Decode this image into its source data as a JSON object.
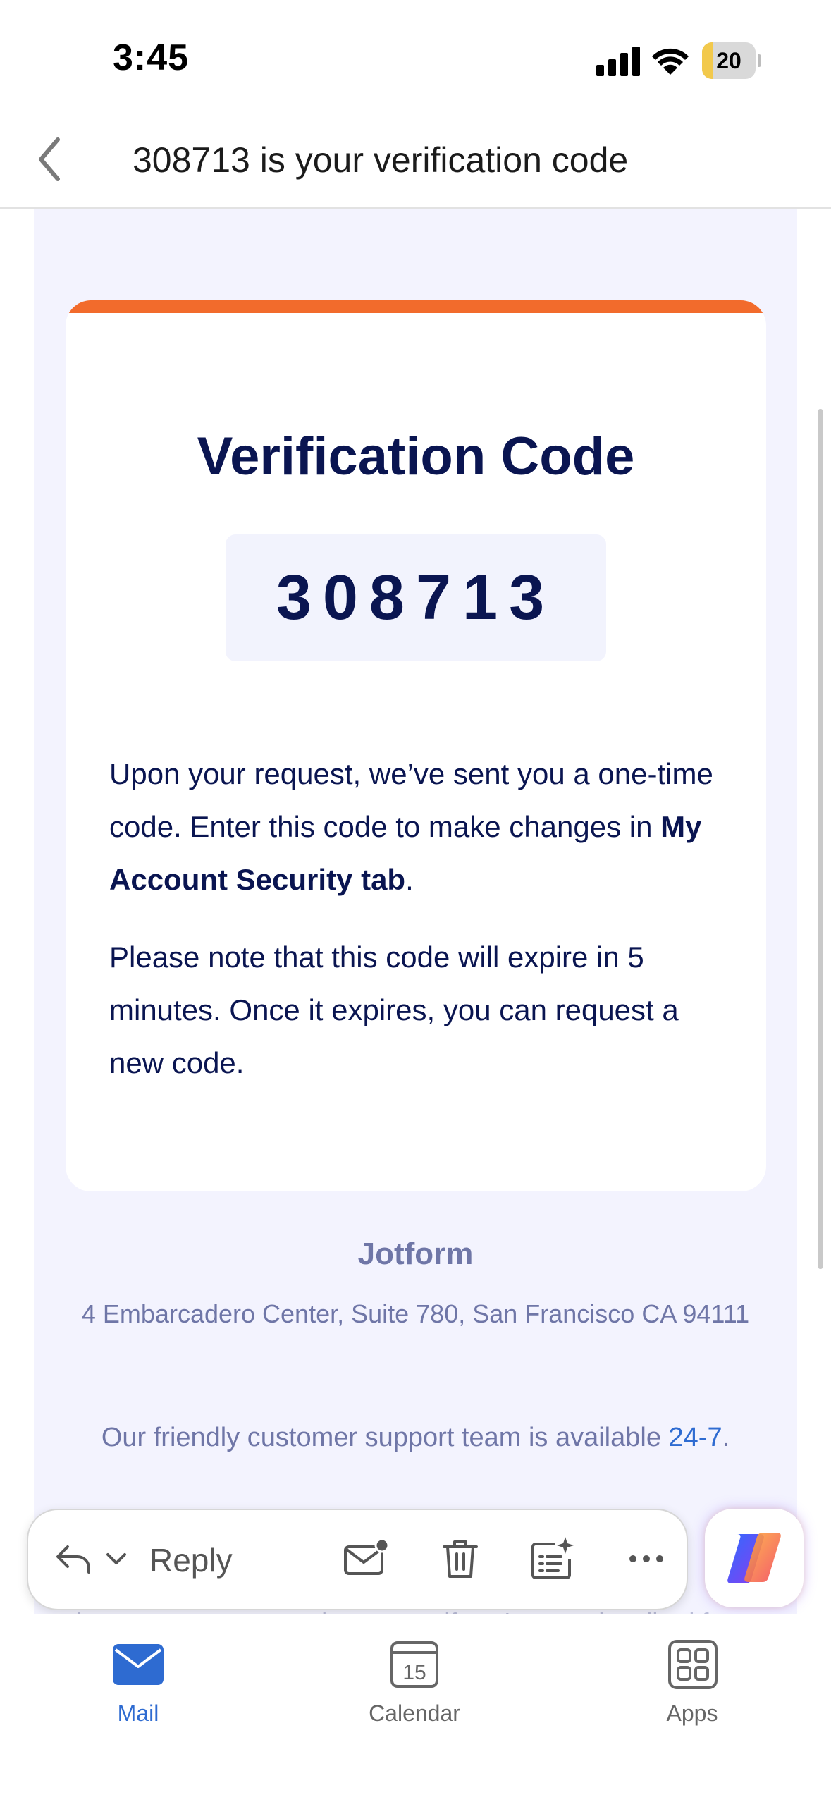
{
  "status_bar": {
    "time": "3:45",
    "battery": "20",
    "battery_level": 0.2
  },
  "header": {
    "subject": "308713 is your verification code"
  },
  "email": {
    "heading": "Verification Code",
    "code": "308713",
    "para1_prefix": "Upon your request, we’ve sent you a one-time code. Enter this code to make changes in ",
    "para1_bold": "My Account Security tab",
    "para1_suffix": ".",
    "para2": "Please note that this code will expire in 5 minutes. Once it expires, you can request a new code.",
    "footer_brand": "Jotform",
    "footer_address": "4 Embarcadero Center, Suite 780, San Francisco CA 94111",
    "support_prefix": "Our friendly customer support team is available ",
    "support_link": "24-7",
    "support_suffix": ".",
    "partial_text": "important account updates even if you've unsubscribed from"
  },
  "reply_bar": {
    "reply_label": "Reply"
  },
  "tabs": [
    {
      "label": "Mail"
    },
    {
      "label": "Calendar",
      "day": "15"
    },
    {
      "label": "Apps"
    }
  ],
  "colors": {
    "accent": "#f26b2c",
    "brand_text": "#0a1551",
    "link": "#2e6bd1"
  }
}
